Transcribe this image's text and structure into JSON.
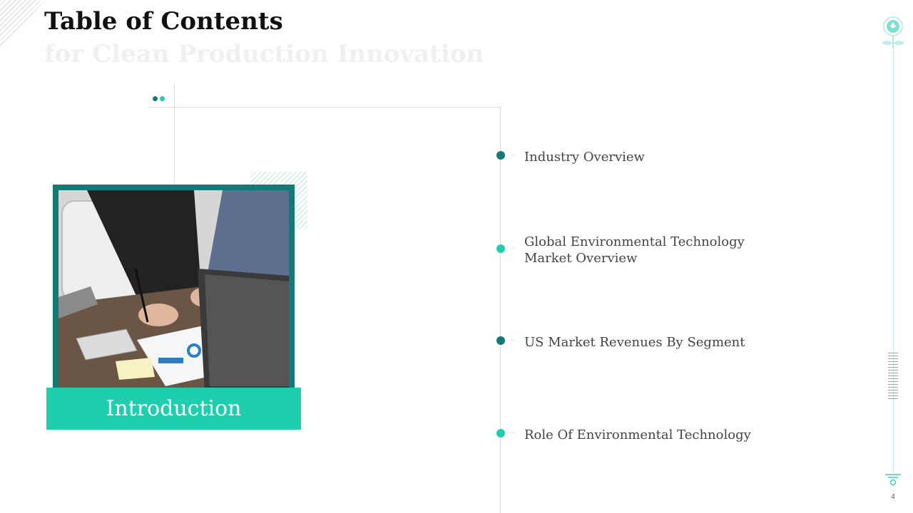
{
  "header": {
    "title": "Table of Contents",
    "subtitle": "for Clean Production Innovation"
  },
  "section": {
    "label": "Introduction"
  },
  "toc": {
    "items": [
      {
        "label": "Industry Overview",
        "dot_color": "#137a78"
      },
      {
        "label": "Global Environmental Technology Market Overview",
        "dot_color": "#1ecfae"
      },
      {
        "label": "US Market Revenues By Segment",
        "dot_color": "#137a78"
      },
      {
        "label": "Role Of Environmental Technology",
        "dot_color": "#1ecfae"
      }
    ]
  },
  "footer": {
    "page_number": "4"
  },
  "colors": {
    "teal_dark": "#137a78",
    "teal_light": "#1ecfae",
    "title": "#111111",
    "subtitle": "#f0f0f0"
  },
  "icons": {
    "bulb": "lightbulb-plant-icon",
    "photo": "business-meeting-photo"
  }
}
